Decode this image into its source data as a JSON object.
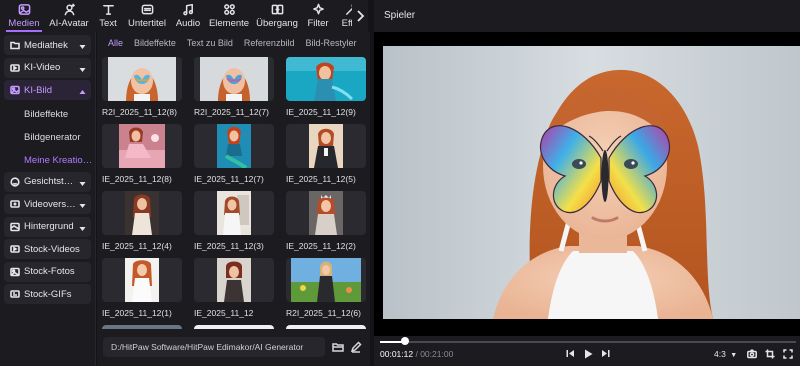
{
  "toolbar": {
    "items": [
      {
        "label": "Medien",
        "icon": "media-icon",
        "active": true
      },
      {
        "label": "AI-Avatar",
        "icon": "avatar-icon"
      },
      {
        "label": "Text",
        "icon": "text-icon"
      },
      {
        "label": "Untertitel",
        "icon": "subtitle-icon"
      },
      {
        "label": "Audio",
        "icon": "audio-icon"
      },
      {
        "label": "Elemente",
        "icon": "elements-icon"
      },
      {
        "label": "Übergang",
        "icon": "transition-icon"
      },
      {
        "label": "Filter",
        "icon": "filter-icon"
      },
      {
        "label": "Effe",
        "icon": "effects-icon"
      }
    ],
    "more_icon": "chevron-right-icon",
    "accent": "#a66dff"
  },
  "sidebar": {
    "items": [
      {
        "label": "Mediathek",
        "icon": "folder-icon",
        "chevron": "down"
      },
      {
        "label": "KI-Video",
        "icon": "ai-video-icon",
        "chevron": "down"
      },
      {
        "label": "KI-Bild",
        "icon": "ai-image-icon",
        "chevron": "up",
        "active": true
      },
      {
        "label": "Gesichtstausch",
        "icon": "face-swap-icon",
        "chevron": "down"
      },
      {
        "label": "Videoverstärk…",
        "icon": "enhance-icon",
        "chevron": "down"
      },
      {
        "label": "Hintergrund",
        "icon": "background-icon",
        "chevron": "down"
      },
      {
        "label": "Stock-Videos",
        "icon": "stock-video-icon"
      },
      {
        "label": "Stock-Fotos",
        "icon": "stock-photo-icon"
      },
      {
        "label": "Stock-GIFs",
        "icon": "stock-gif-icon"
      }
    ],
    "subitems": [
      {
        "label": "Bildeffekte"
      },
      {
        "label": "Bildgenerator"
      },
      {
        "label": "Meine Kreatio…",
        "active": true
      }
    ]
  },
  "media": {
    "tabs": [
      {
        "label": "Alle",
        "active": true
      },
      {
        "label": "Bildeffekte"
      },
      {
        "label": "Text zu Bild"
      },
      {
        "label": "Referenzbild"
      },
      {
        "label": "Bild-Restyler"
      }
    ],
    "items": [
      {
        "name": "R2I_2025_11_12(8)",
        "style": "face"
      },
      {
        "name": "R2I_2025_11_12(7)",
        "style": "face"
      },
      {
        "name": "IE_2025_11_12(9)",
        "style": "water"
      },
      {
        "name": "IE_2025_11_12(8)",
        "style": "pink"
      },
      {
        "name": "IE_2025_11_12(7)",
        "style": "mermaid"
      },
      {
        "name": "IE_2025_11_12(5)",
        "style": "portrait"
      },
      {
        "name": "IE_2025_11_12(4)",
        "style": "girl"
      },
      {
        "name": "IE_2025_11_12(3)",
        "style": "mirror"
      },
      {
        "name": "IE_2025_11_12(2)",
        "style": "crown"
      },
      {
        "name": "IE_2025_11_12(1)",
        "style": "light"
      },
      {
        "name": "IE_2025_11_12",
        "style": "bob"
      },
      {
        "name": "R2I_2025_11_12(6)",
        "style": "meadow"
      }
    ],
    "path": "D:/HitPaw Software/HitPaw Edimakor/AI Generator",
    "path_icons": [
      "folder-open-icon",
      "edit-icon"
    ]
  },
  "player": {
    "title": "Spieler",
    "current_time": "00:01:12",
    "total_time": "00:21:00",
    "progress": 0.06,
    "aspect_ratio": "4:3",
    "controls": [
      "previous-frame-icon",
      "play-icon",
      "next-frame-icon"
    ],
    "tools": [
      "snapshot-icon",
      "crop-icon",
      "fullscreen-icon"
    ]
  }
}
